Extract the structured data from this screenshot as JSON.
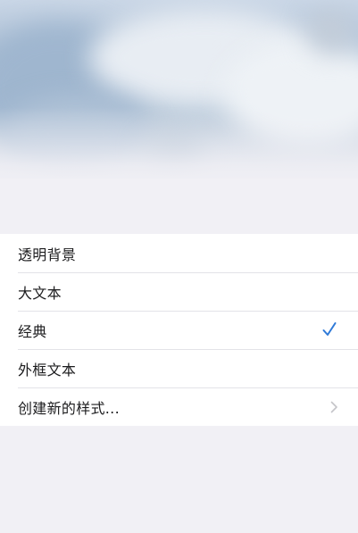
{
  "menu": {
    "items": [
      {
        "label": "透明背景",
        "icon": null
      },
      {
        "label": "大文本",
        "icon": null
      },
      {
        "label": "经典",
        "icon": "checkmark-icon",
        "selected": true
      },
      {
        "label": "外框文本",
        "icon": null
      },
      {
        "label": "创建新的样式...",
        "icon": "chevron-right-icon"
      }
    ]
  },
  "colors": {
    "accent": "#2f7ad8",
    "chevron": "#c4c4c8",
    "background": "#f1f0f5"
  }
}
